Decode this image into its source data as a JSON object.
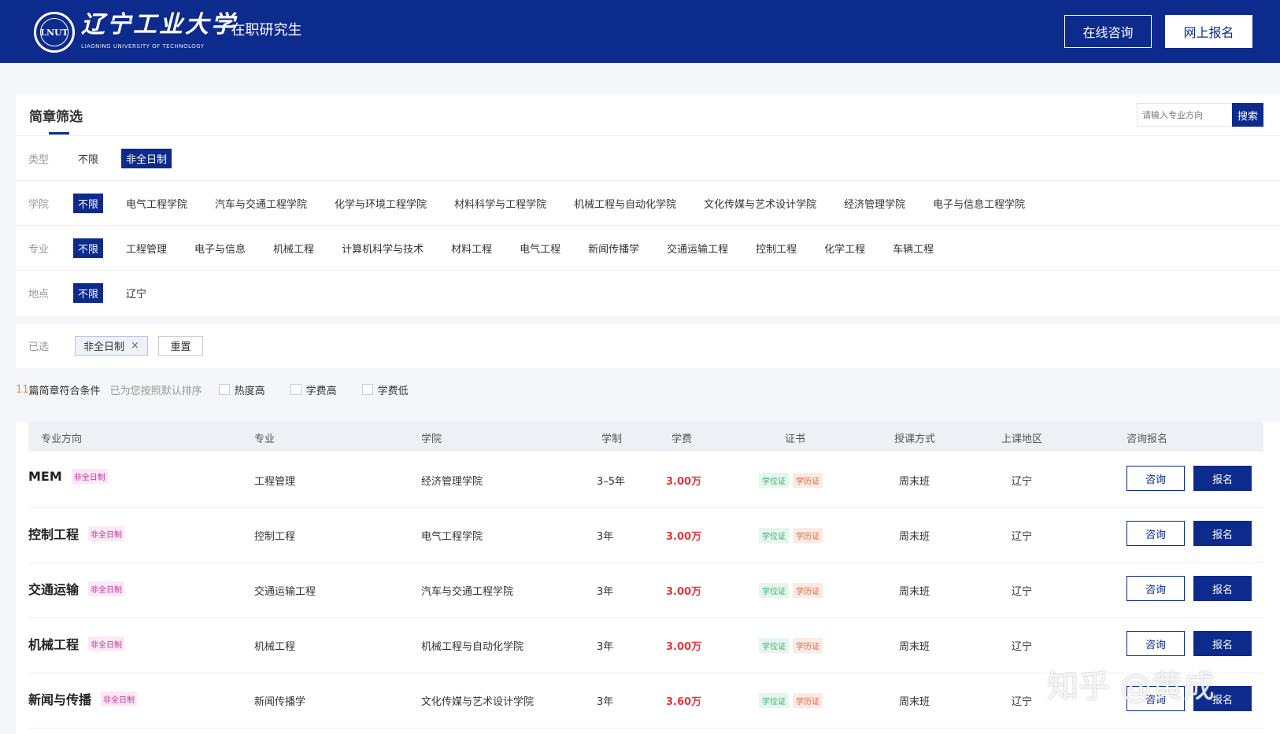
{
  "header": {
    "seal_text": "LNUT",
    "logo_name": "辽宁工业大学",
    "logo_en": "LIAONING UNIVERSITY OF TECHNOLOGY",
    "subtitle": "· 在职研究生",
    "consult_label": "在线咨询",
    "apply_label": "网上报名"
  },
  "filter": {
    "title": "简章筛选",
    "search_placeholder": "请输入专业方向",
    "search_label": "搜索",
    "rows": [
      {
        "label": "类型",
        "options": [
          "不限",
          "非全日制"
        ],
        "active": 1
      },
      {
        "label": "学院",
        "options": [
          "不限",
          "电气工程学院",
          "汽车与交通工程学院",
          "化学与环境工程学院",
          "材料科学与工程学院",
          "机械工程与自动化学院",
          "文化传媒与艺术设计学院",
          "经济管理学院",
          "电子与信息工程学院"
        ],
        "active": 0
      },
      {
        "label": "专业",
        "options": [
          "不限",
          "工程管理",
          "电子与信息",
          "机械工程",
          "计算机科学与技术",
          "材料工程",
          "电气工程",
          "新闻传播学",
          "交通运输工程",
          "控制工程",
          "化学工程",
          "车辆工程"
        ],
        "active": 0
      },
      {
        "label": "地点",
        "options": [
          "不限",
          "辽宁"
        ],
        "active": 0
      }
    ]
  },
  "selected": {
    "label": "已选",
    "tag": "非全日制",
    "remove_icon": "×",
    "reset_label": "重置"
  },
  "sortbar": {
    "count": "11",
    "count_text": "篇简章符合条件",
    "hint": "已为您按照默认排序",
    "options": [
      "热度高",
      "学费高",
      "学费低"
    ]
  },
  "table": {
    "headers": [
      "专业方向",
      "专业",
      "学院",
      "学制",
      "学费",
      "证书",
      "授课方式",
      "上课地区",
      "咨询报名"
    ],
    "rows": [
      {
        "direction": "MEM",
        "type": "非全日制",
        "major": "工程管理",
        "college": "经济管理学院",
        "duration": "3–5年",
        "fee": "3.00万",
        "cert_degree": "学位证",
        "cert_edu": "学历证",
        "mode": "周末班",
        "region": "辽宁",
        "consult": "咨询",
        "apply": "报名"
      },
      {
        "direction": "控制工程",
        "type": "非全日制",
        "major": "控制工程",
        "college": "电气工程学院",
        "duration": "3年",
        "fee": "3.00万",
        "cert_degree": "学位证",
        "cert_edu": "学历证",
        "mode": "周末班",
        "region": "辽宁",
        "consult": "咨询",
        "apply": "报名"
      },
      {
        "direction": "交通运输",
        "type": "非全日制",
        "major": "交通运输工程",
        "college": "汽车与交通工程学院",
        "duration": "3年",
        "fee": "3.00万",
        "cert_degree": "学位证",
        "cert_edu": "学历证",
        "mode": "周末班",
        "region": "辽宁",
        "consult": "咨询",
        "apply": "报名"
      },
      {
        "direction": "机械工程",
        "type": "非全日制",
        "major": "机械工程",
        "college": "机械工程与自动化学院",
        "duration": "3年",
        "fee": "3.00万",
        "cert_degree": "学位证",
        "cert_edu": "学历证",
        "mode": "周末班",
        "region": "辽宁",
        "consult": "咨询",
        "apply": "报名"
      },
      {
        "direction": "新闻与传播",
        "type": "非全日制",
        "major": "新闻传播学",
        "college": "文化传媒与艺术设计学院",
        "duration": "3年",
        "fee": "3.60万",
        "cert_degree": "学位证",
        "cert_edu": "学历证",
        "mode": "周末班",
        "region": "辽宁",
        "consult": "咨询",
        "apply": "报名"
      }
    ]
  },
  "watermark": "知乎 @黄成",
  "colors": {
    "brand": "#0d2b8c",
    "fee": "#e2363c",
    "count": "#f08a3c"
  }
}
